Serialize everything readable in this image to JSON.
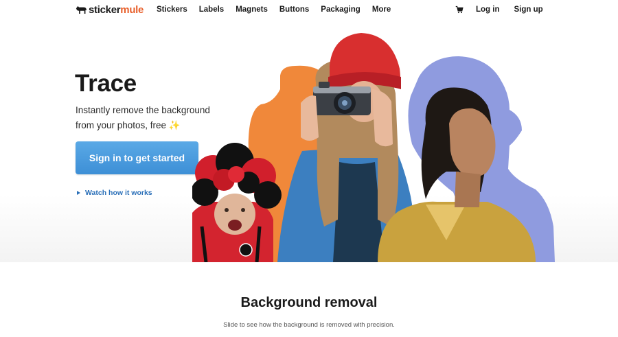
{
  "brand": {
    "part1": "sticker",
    "part2": "mule",
    "accent_color": "#e8602c"
  },
  "nav": {
    "links": [
      "Stickers",
      "Labels",
      "Magnets",
      "Buttons",
      "Packaging",
      "More"
    ],
    "cart_icon": "cart-icon",
    "login": "Log in",
    "signup": "Sign up"
  },
  "hero": {
    "title": "Trace",
    "subtitle_line1": "Instantly remove the background",
    "subtitle_line2": "from your photos, free",
    "sparkle": "✨",
    "cta_label": "Sign in to get started",
    "cta_color": "#4a9de0",
    "watch_label": "Watch how it works",
    "silhouette_colors": {
      "orange": "#f0883a",
      "blue": "#8f9bdf"
    }
  },
  "section2": {
    "title": "Background removal",
    "subtitle": "Slide to see how the background is removed with precision."
  }
}
